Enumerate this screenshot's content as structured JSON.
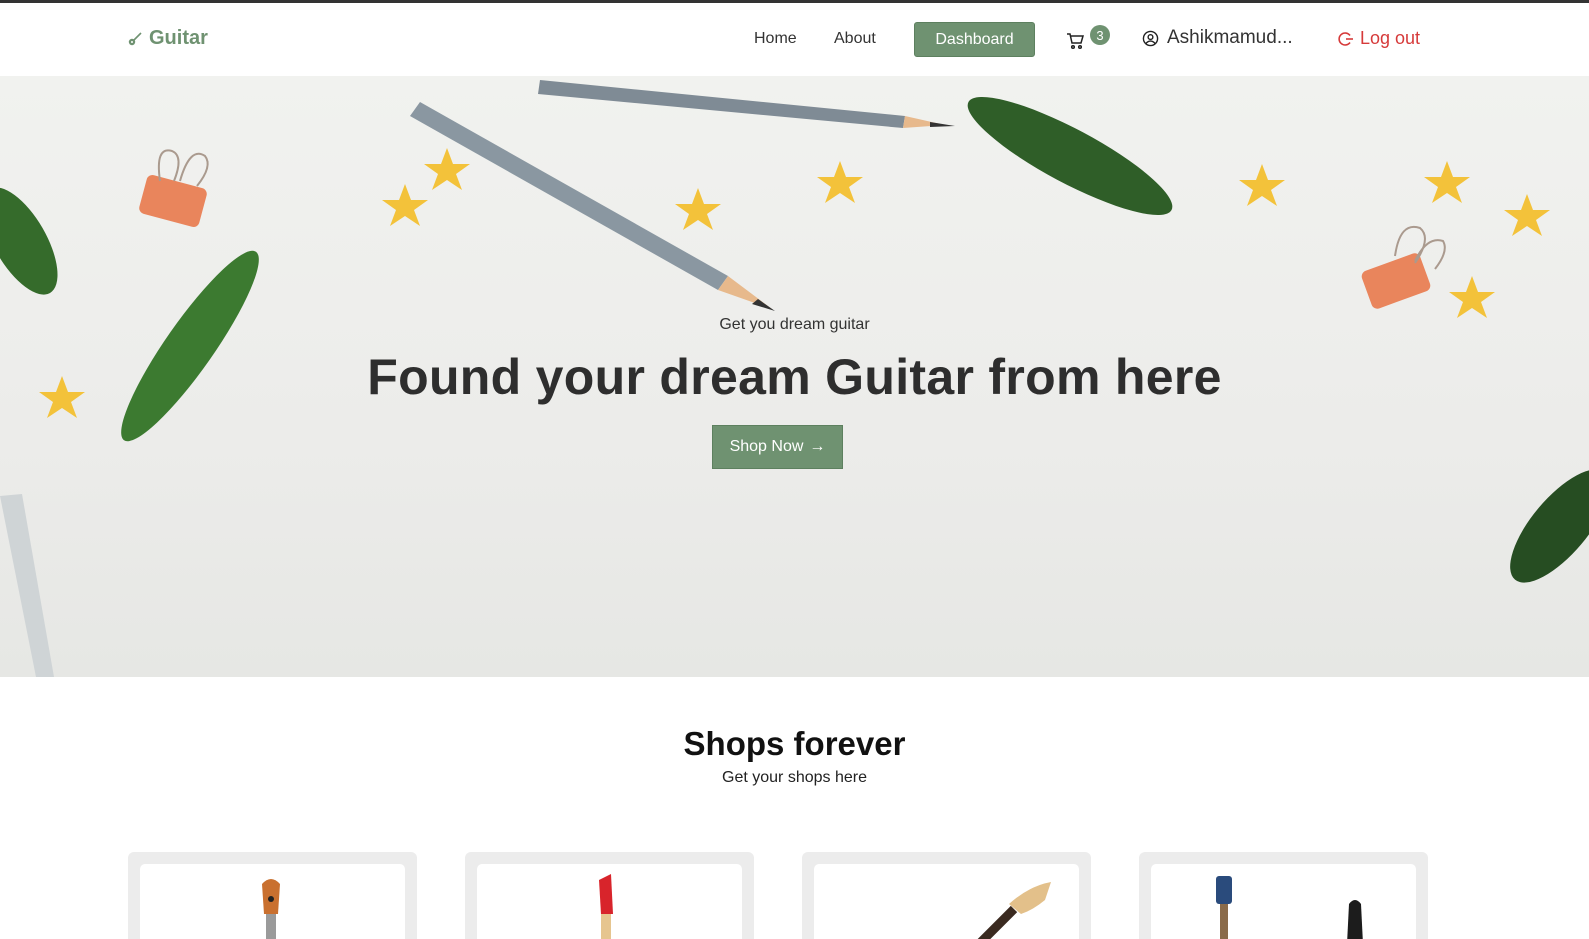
{
  "brand": {
    "name": "Guitar",
    "icon": "guitar-icon",
    "color": "#6f9271"
  },
  "nav": {
    "home": "Home",
    "about": "About",
    "dashboard": "Dashboard",
    "cart_icon": "cart-icon",
    "cart_count": "3",
    "user_icon": "user-circle-icon",
    "user_name": "Ashikmamud...",
    "logout_icon": "logout-icon",
    "logout": "Log out"
  },
  "hero": {
    "subtitle": "Get you dream guitar",
    "title": "Found your dream Guitar from here",
    "button": "Shop Now",
    "button_icon": "arrow-right-icon"
  },
  "shops": {
    "title": "Shops forever",
    "subtitle": "Get your shops here"
  },
  "colors": {
    "accent": "#6f9271",
    "logout": "#d63a3a"
  }
}
